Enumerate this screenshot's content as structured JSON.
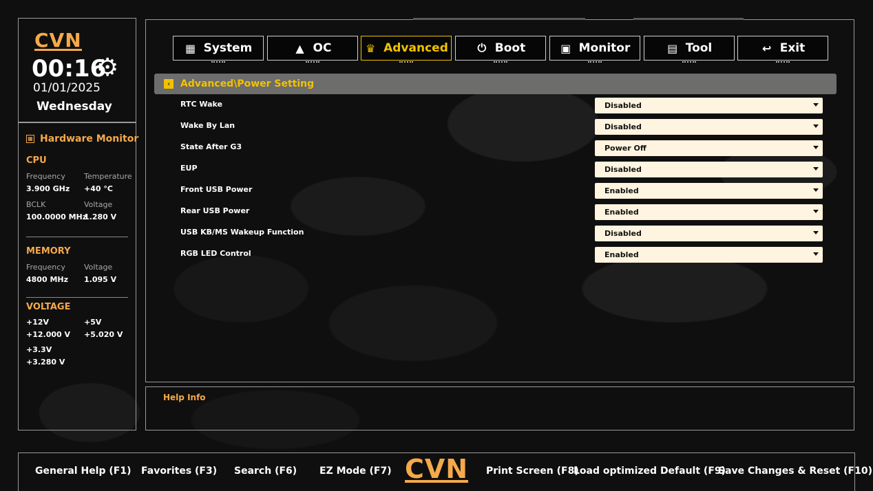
{
  "brand": {
    "logo_text": "CVN",
    "accent": "#f5a94a",
    "highlight": "#f2c200"
  },
  "clock": {
    "time": "00:16",
    "date": "01/01/2025",
    "weekday": "Wednesday"
  },
  "hardware_monitor": {
    "title": "Hardware Monitor",
    "cpu": {
      "title": "CPU",
      "frequency_label": "Frequency",
      "frequency_value": "3.900 GHz",
      "temperature_label": "Temperature",
      "temperature_value": "+40 °C",
      "bclk_label": "BCLK",
      "bclk_value": "100.0000 MHz",
      "voltage_label": "Voltage",
      "voltage_value": "1.280 V"
    },
    "memory": {
      "title": "MEMORY",
      "frequency_label": "Frequency",
      "frequency_value": "4800 MHz",
      "voltage_label": "Voltage",
      "voltage_value": "1.095 V"
    },
    "voltage": {
      "title": "VOLTAGE",
      "v12_label": "+12V",
      "v12_value": "+12.000 V",
      "v5_label": "+5V",
      "v5_value": "+5.020 V",
      "v33_label": "+3.3V",
      "v33_value": "+3.280 V"
    }
  },
  "tabs": [
    {
      "label": "System",
      "icon": "grid-icon"
    },
    {
      "label": "OC",
      "icon": "rocket-icon"
    },
    {
      "label": "Advanced",
      "icon": "crown-icon",
      "active": true
    },
    {
      "label": "Boot",
      "icon": "power-icon"
    },
    {
      "label": "Monitor",
      "icon": "pulse-icon"
    },
    {
      "label": "Tool",
      "icon": "toolbox-icon"
    },
    {
      "label": "Exit",
      "icon": "return-icon"
    }
  ],
  "breadcrumb": "Advanced\\Power Setting",
  "settings": [
    {
      "label": "RTC Wake",
      "value": "Disabled"
    },
    {
      "label": "Wake By Lan",
      "value": "Disabled"
    },
    {
      "label": "State After G3",
      "value": "Power Off"
    },
    {
      "label": "EUP",
      "value": "Disabled"
    },
    {
      "label": "Front USB Power",
      "value": "Enabled"
    },
    {
      "label": "Rear USB Power",
      "value": "Enabled"
    },
    {
      "label": "USB KB/MS Wakeup Function",
      "value": "Disabled"
    },
    {
      "label": "RGB LED Control",
      "value": "Enabled"
    }
  ],
  "help": {
    "title": "Help Info"
  },
  "footer": {
    "f1": "General Help (F1)",
    "f3": "Favorites (F3)",
    "f6": "Search (F6)",
    "f7": "EZ Mode (F7)",
    "f8": "Print Screen (F8)",
    "f9": "Load optimized Default (F9)",
    "f10": "Save Changes & Reset (F10)"
  }
}
